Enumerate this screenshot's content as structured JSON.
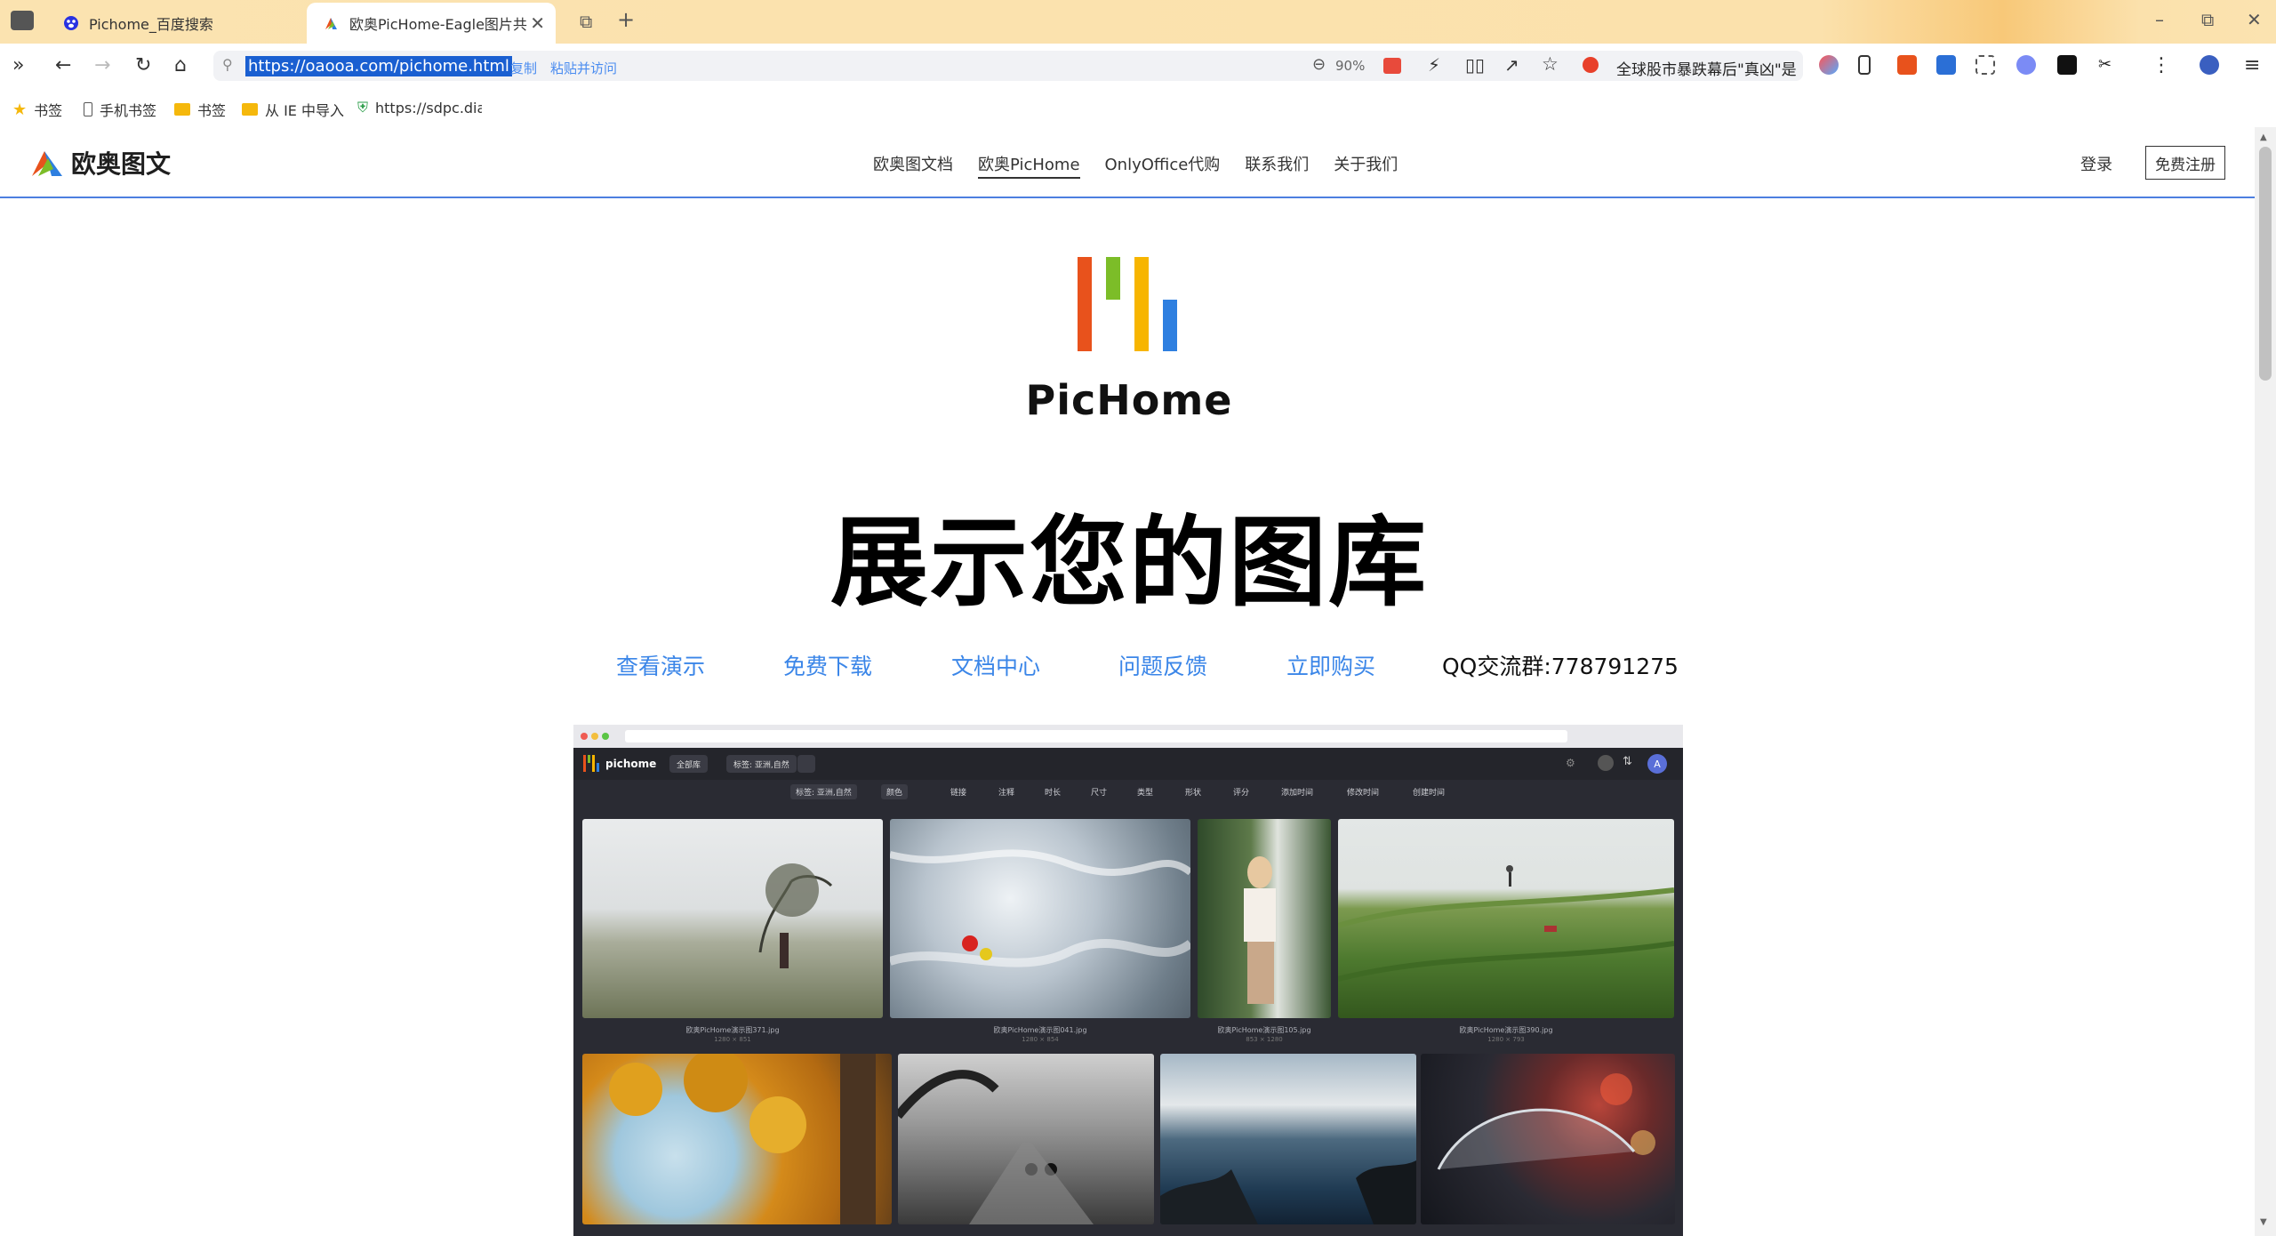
{
  "browser": {
    "tabs": [
      {
        "title": "Pichome_百度搜索"
      },
      {
        "title": "欧奥PicHome-Eagle图片共享"
      }
    ],
    "url": "https://oaooa.com/pichome.html",
    "url_actions": {
      "copy": "复制",
      "paste_go": "粘贴并访问"
    },
    "zoom": "90%",
    "news_ticker": "全球股市暴跌幕后\"真凶\"是",
    "bookmarks": [
      {
        "label": "书签",
        "icon": "star-icon"
      },
      {
        "label": "手机书签",
        "icon": "phone-icon"
      },
      {
        "label": "书签",
        "icon": "folder-icon"
      },
      {
        "label": "从 IE 中导入",
        "icon": "folder-icon"
      },
      {
        "label": "https://sdpc.dian",
        "icon": "shield-icon"
      }
    ]
  },
  "site": {
    "logo_text": "欧奥图文",
    "nav": [
      "欧奥图文档",
      "欧奥PicHome",
      "OnlyOffice代购",
      "联系我们",
      "关于我们"
    ],
    "login": "登录",
    "register": "免费注册",
    "brand_name": "PicHome",
    "hero_title": "展示您的图库",
    "links": [
      "查看演示",
      "免费下载",
      "文档中心",
      "问题反馈",
      "立即购买"
    ],
    "qq_group": "QQ交流群:778791275"
  },
  "demo": {
    "app_name": "pichome",
    "library_chip": "全部库",
    "tag_chip": "标签: 亚洲,自然",
    "filters": [
      "标签: 亚洲,自然",
      "颜色",
      "链接",
      "注释",
      "时长",
      "尺寸",
      "类型",
      "形状",
      "评分",
      "添加时间",
      "修改时间",
      "创建时间"
    ],
    "avatar_letter": "A",
    "photos": [
      {
        "caption": "欧奥PicHome演示图371.jpg",
        "size": "1280 × 851"
      },
      {
        "caption": "欧奥PicHome演示图041.jpg",
        "size": "1280 × 854"
      },
      {
        "caption": "欧奥PicHome演示图105.jpg",
        "size": "853 × 1280"
      },
      {
        "caption": "欧奥PicHome演示图390.jpg",
        "size": "1280 × 793"
      }
    ],
    "colors": {
      "accent": "#3b86e8",
      "brand_orange": "#e8521c",
      "brand_green": "#7cbd28",
      "brand_yellow": "#f7b500",
      "brand_blue": "#2e7fe0"
    }
  }
}
